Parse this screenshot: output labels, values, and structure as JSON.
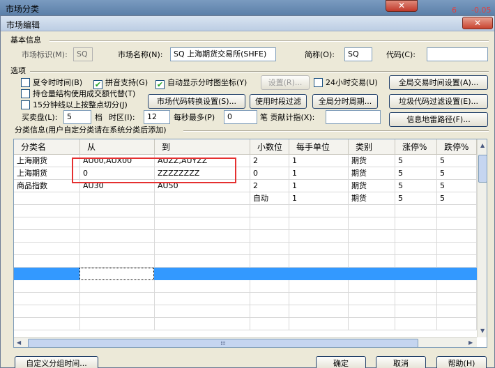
{
  "outer": {
    "title": "市场分类",
    "close": "✕",
    "ticker_a": "6",
    "ticker_b": "-0.05"
  },
  "dialog": {
    "title": "市场编辑",
    "close": "✕"
  },
  "basic": {
    "group_title": "基本信息",
    "market_id_label": "市场标识(M):",
    "market_id_value": "SQ",
    "market_name_label": "市场名称(N):",
    "market_name_value": "SQ 上海期货交易所(SHFE)",
    "abbr_label": "简称(O):",
    "abbr_value": "SQ",
    "code_label": "代码(C):",
    "code_value": ""
  },
  "options": {
    "group_title": "选项",
    "checkboxes": [
      {
        "label": "夏令时时间(B)",
        "checked": false
      },
      {
        "label": "拼音支持(G)",
        "checked": true
      },
      {
        "label": "自动显示分时图坐标(Y)",
        "checked": true
      },
      {
        "label": "24小时交易(U)",
        "checked": false
      },
      {
        "label": "持仓量结构使用成交额代替(T)",
        "checked": false
      },
      {
        "label": "15分钟线以上按整点切分(J)",
        "checked": false
      }
    ],
    "settings_button": "设置(R)...",
    "global_trade_time_button": "全局交易时间设置(A)...",
    "code_convert_button": "市场代码转换设置(S)...",
    "use_period_filter_button": "使用时段过滤",
    "global_time_period_button": "全局分时周期...",
    "junk_code_filter_button": "垃圾代码过滤设置(E)...",
    "buysell_label": "买卖盘(L):",
    "buysell_value": "5",
    "level_label": "档",
    "timezone_label": "时区(I):",
    "timezone_value": "12",
    "per_second_label": "每秒最多(P)",
    "per_second_value": "0",
    "contribution_label": "笔 贡献计指(X):",
    "contribution_value": "",
    "mine_path_button": "信息地雷路径(F)..."
  },
  "category": {
    "group_title": "分类信息(用户自定分类请在系统分类后添加)",
    "headers": [
      "分类名",
      "从",
      "到",
      "小数位",
      "每手单位",
      "类别",
      "涨停%",
      "跌停%"
    ],
    "rows": [
      [
        "上海期货",
        "AU00,AUX00",
        "AUZZ,AUYZZ",
        "2",
        "1",
        "期货",
        "5",
        "5"
      ],
      [
        "上海期货",
        "0",
        "ZZZZZZZZ",
        "0",
        "1",
        "期货",
        "5",
        "5"
      ],
      [
        "商品指数",
        "AU30",
        "AU50",
        "2",
        "1",
        "期货",
        "5",
        "5"
      ],
      [
        "",
        "",
        "",
        "自动",
        "1",
        "期货",
        "5",
        "5"
      ]
    ]
  },
  "footer": {
    "custom_group_time_button": "自定义分组时间...",
    "ok_button": "确定",
    "cancel_button": "取消",
    "help_button": "帮助(H)"
  },
  "colors": {
    "selection": "#3399ff",
    "highlight_box": "#e53030",
    "dialog_bg": "#ece9d8"
  }
}
